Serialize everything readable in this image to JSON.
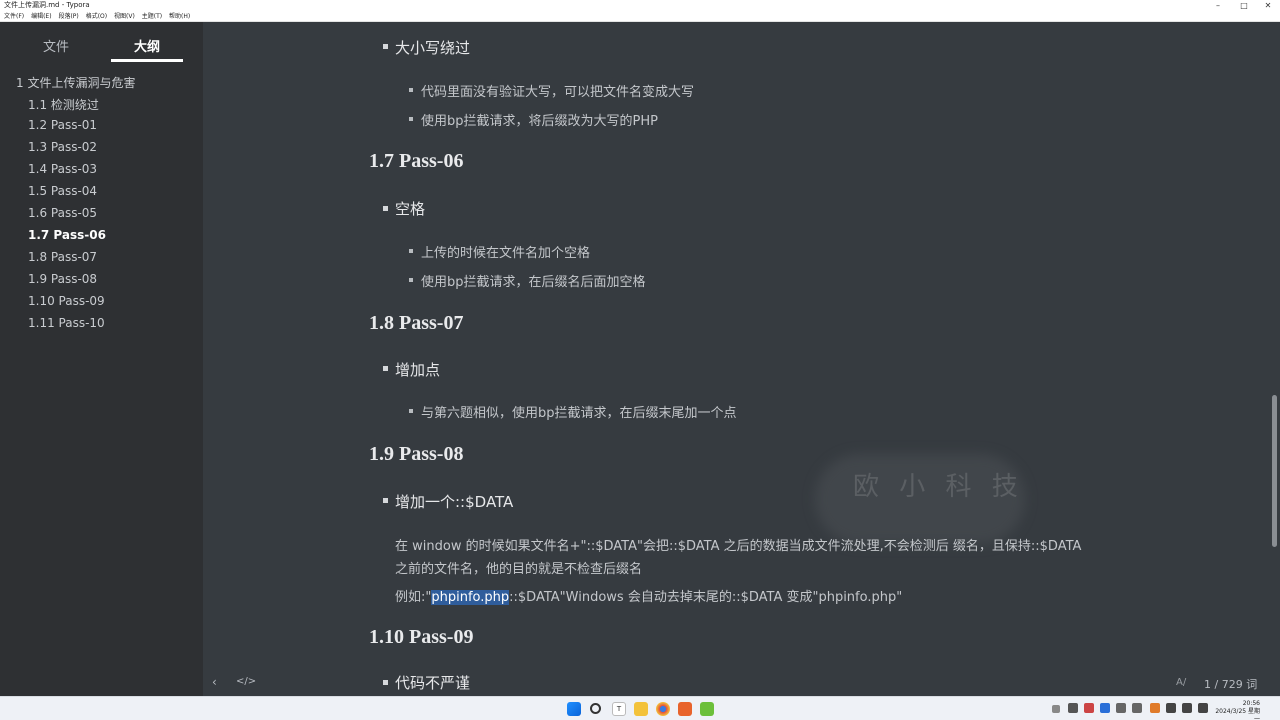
{
  "window": {
    "title": "文件上传漏洞.md - Typora",
    "min": "–",
    "max": "□",
    "close": "✕"
  },
  "menu": [
    "文件(F)",
    "编辑(E)",
    "段落(P)",
    "格式(O)",
    "视图(V)",
    "主题(T)",
    "帮助(H)"
  ],
  "sidebar": {
    "tabs": [
      {
        "label": "文件"
      },
      {
        "label": "大纲",
        "active": true
      }
    ],
    "outline": [
      {
        "label": "1 文件上传漏洞与危害"
      },
      {
        "label": "1.1 检测绕过"
      },
      {
        "label": "1.2 Pass-01"
      },
      {
        "label": "1.3 Pass-02"
      },
      {
        "label": "1.4 Pass-03"
      },
      {
        "label": "1.5 Pass-04"
      },
      {
        "label": "1.6 Pass-05"
      },
      {
        "label": "1.7 Pass-06",
        "active": true
      },
      {
        "label": "1.8 Pass-07"
      },
      {
        "label": "1.9 Pass-08"
      },
      {
        "label": "1.10 Pass-09"
      },
      {
        "label": "1.11 Pass-10"
      }
    ]
  },
  "doc": {
    "b0": {
      "title": "大小写绕过",
      "items": [
        "代码里面没有验证大写，可以把文件名变成大写",
        "使用bp拦截请求，将后缀改为大写的PHP"
      ]
    },
    "h17": "1.7 Pass-06",
    "b1": {
      "title": "空格",
      "items": [
        "上传的时候在文件名加个空格",
        "使用bp拦截请求，在后缀名后面加空格"
      ]
    },
    "h18": "1.8 Pass-07",
    "b2": {
      "title": "增加点",
      "items": [
        "与第六题相似，使用bp拦截请求，在后缀末尾加一个点"
      ]
    },
    "h19": "1.9 Pass-08",
    "b3": {
      "title": "增加一个::$DATA"
    },
    "para1_line1": "在 window 的时候如果文件名+\"::$DATA\"会把::$DATA 之后的数据当成文件流处理,不会检测后 缀名，且保持::$DATA",
    "para1_line2": "之前的文件名，他的目的就是不检查后缀名",
    "para2_pre": "例如:\"",
    "para2_sel": "phpinfo.php",
    "para2_post": "::$DATA\"Windows 会自动去掉末尾的::$DATA 变成\"phpinfo.php\"",
    "h110": "1.10 Pass-09",
    "b4": {
      "title": "代码不严谨"
    }
  },
  "watermark": "欧 小 科 技",
  "footer": {
    "back": "‹",
    "source": "</>",
    "word_count": "1 / 729 词"
  },
  "clock": {
    "time": "20:56",
    "date": "2024/3/25 星期一"
  },
  "colors": {
    "bg": "#363b40",
    "sidebar": "#2e3033",
    "selection": "#2f5d9c"
  },
  "icons": [
    "windows-start-icon",
    "search-icon",
    "typora-icon",
    "file-explorer-icon",
    "chrome-icon",
    "burp-icon",
    "green-app-icon"
  ]
}
